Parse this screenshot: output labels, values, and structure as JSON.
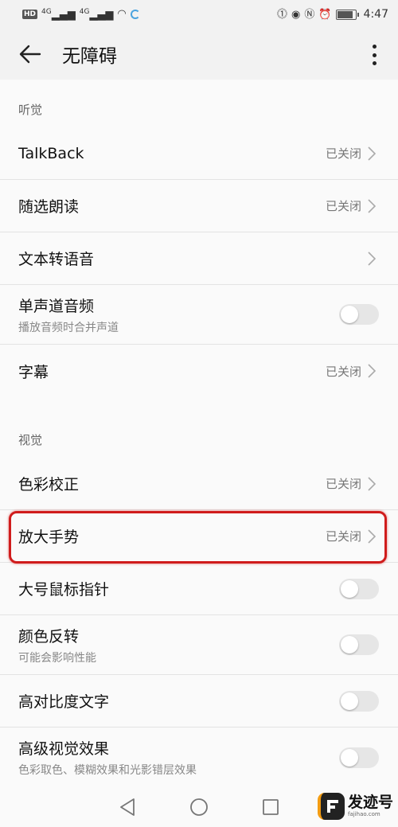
{
  "status_bar": {
    "badge": "HD",
    "net1": "4G",
    "net2": "4G",
    "time": "4:47",
    "battery_level": 0.9
  },
  "app_bar": {
    "title": "无障碍",
    "back_icon": "arrow-left-icon",
    "more_icon": "more-vertical-icon"
  },
  "hearing": {
    "header": "听觉",
    "items": [
      {
        "label": "TalkBack",
        "value": "已关闭",
        "control": "chevron"
      },
      {
        "label": "随选朗读",
        "value": "已关闭",
        "control": "chevron"
      },
      {
        "label": "文本转语音",
        "value": "",
        "control": "chevron"
      },
      {
        "label": "单声道音频",
        "sub": "播放音频时合并声道",
        "control": "toggle",
        "on": false
      },
      {
        "label": "字幕",
        "value": "已关闭",
        "control": "chevron"
      }
    ]
  },
  "vision": {
    "header": "视觉",
    "items": [
      {
        "label": "色彩校正",
        "value": "已关闭",
        "control": "chevron"
      },
      {
        "label": "放大手势",
        "value": "已关闭",
        "control": "chevron"
      },
      {
        "label": "大号鼠标指针",
        "control": "toggle",
        "on": false
      },
      {
        "label": "颜色反转",
        "sub": "可能会影响性能",
        "control": "toggle",
        "on": false
      },
      {
        "label": "高对比度文字",
        "control": "toggle",
        "on": false
      },
      {
        "label": "高级视觉效果",
        "sub": "色彩取色、模糊效果和光影错层效果",
        "control": "toggle",
        "on": false
      }
    ]
  },
  "nav_bar": {
    "icons": [
      "nav-back-icon",
      "nav-home-icon",
      "nav-recents-icon"
    ]
  },
  "watermark": {
    "title": "发迹号",
    "url": "fajihao.com"
  },
  "colors": {
    "highlight": "#d01c1c",
    "background": "#fafafa",
    "toggle_off": "#e6e6e6"
  }
}
